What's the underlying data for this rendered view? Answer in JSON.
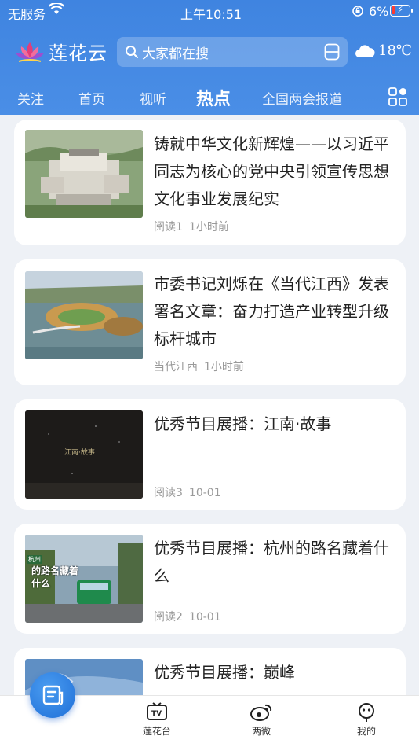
{
  "status_bar": {
    "carrier": "无服务",
    "time": "上午10:51",
    "battery": "6%"
  },
  "header": {
    "app_name": "莲花云",
    "search_placeholder": "大家都在搜",
    "temperature": "18℃",
    "tabs": [
      {
        "label": "关注",
        "active": false
      },
      {
        "label": "首页",
        "active": false
      },
      {
        "label": "视听",
        "active": false
      },
      {
        "label": "热点",
        "active": true
      },
      {
        "label": "全国两会报道",
        "active": false
      }
    ]
  },
  "feed": [
    {
      "title": "铸就中华文化新辉煌——以习近平同志为核心的党中央引领宣传思想文化事业发展纪实",
      "source": "阅读1",
      "time": "1小时前"
    },
    {
      "title": "市委书记刘烁在《当代江西》发表署名文章：奋力打造产业转型升级标杆城市",
      "source": "当代江西",
      "time": "1小时前"
    },
    {
      "title": "优秀节目展播：江南·故事",
      "source": "阅读3",
      "time": "10-01",
      "thumb_text": "江南·故事"
    },
    {
      "title": "优秀节目展播：杭州的路名藏着什么",
      "source": "阅读2",
      "time": "10-01",
      "thumb_text": "的路名藏着什么",
      "thumb_badge": "杭州"
    },
    {
      "title": "优秀节目展播：巅峰",
      "source": "",
      "time": ""
    }
  ],
  "bottom_nav": [
    {
      "label": "莲花台",
      "icon": "tv-icon"
    },
    {
      "label": "两微",
      "icon": "weibo-icon"
    },
    {
      "label": "我的",
      "icon": "profile-icon"
    }
  ],
  "colors": {
    "accent": "#4a8ee6",
    "battery_low": "#ff3b30"
  }
}
